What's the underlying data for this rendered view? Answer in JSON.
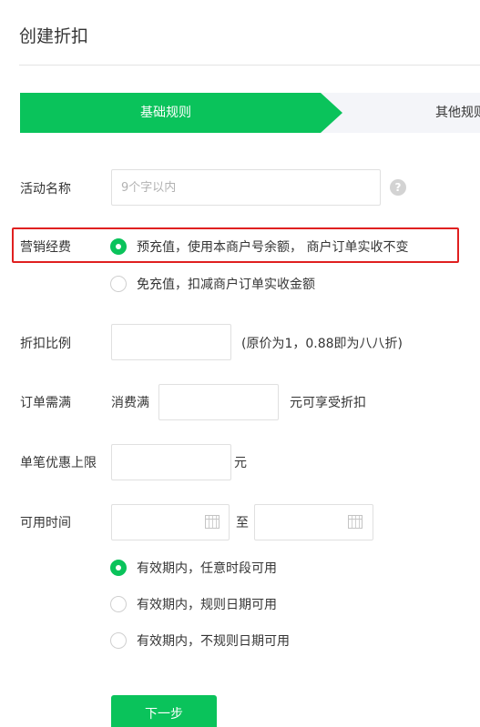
{
  "page": {
    "title": "创建折扣"
  },
  "steps": [
    {
      "label": "基础规则",
      "active": true
    },
    {
      "label": "其他规则",
      "active": false
    }
  ],
  "accent_color": "#0ac35b",
  "highlight_color": "#e02020",
  "form": {
    "activity_name": {
      "label": "活动名称",
      "value": "",
      "placeholder": "9个字以内",
      "help_icon": "question-circle-icon"
    },
    "marketing_fee": {
      "label": "营销经费",
      "options": [
        {
          "label": "预充值，使用本商户号余额， 商户订单实收不变",
          "checked": true
        },
        {
          "label": "免充值，扣减商户订单实收金额",
          "checked": false
        }
      ]
    },
    "discount_ratio": {
      "label": "折扣比例",
      "value": "",
      "hint": "(原价为1，0.88即为八八折)"
    },
    "order_threshold": {
      "label": "订单需满",
      "prefix": "消费满",
      "value": "",
      "suffix": "元可享受折扣"
    },
    "max_discount": {
      "label": "单笔优惠上限",
      "value": "",
      "suffix": "元"
    },
    "available_time": {
      "label": "可用时间",
      "start_value": "",
      "separator": "至",
      "end_value": "",
      "options": [
        {
          "label": "有效期内，任意时段可用",
          "checked": true
        },
        {
          "label": "有效期内，规则日期可用",
          "checked": false
        },
        {
          "label": "有效期内，不规则日期可用",
          "checked": false
        }
      ]
    }
  },
  "actions": {
    "next_label": "下一步"
  }
}
